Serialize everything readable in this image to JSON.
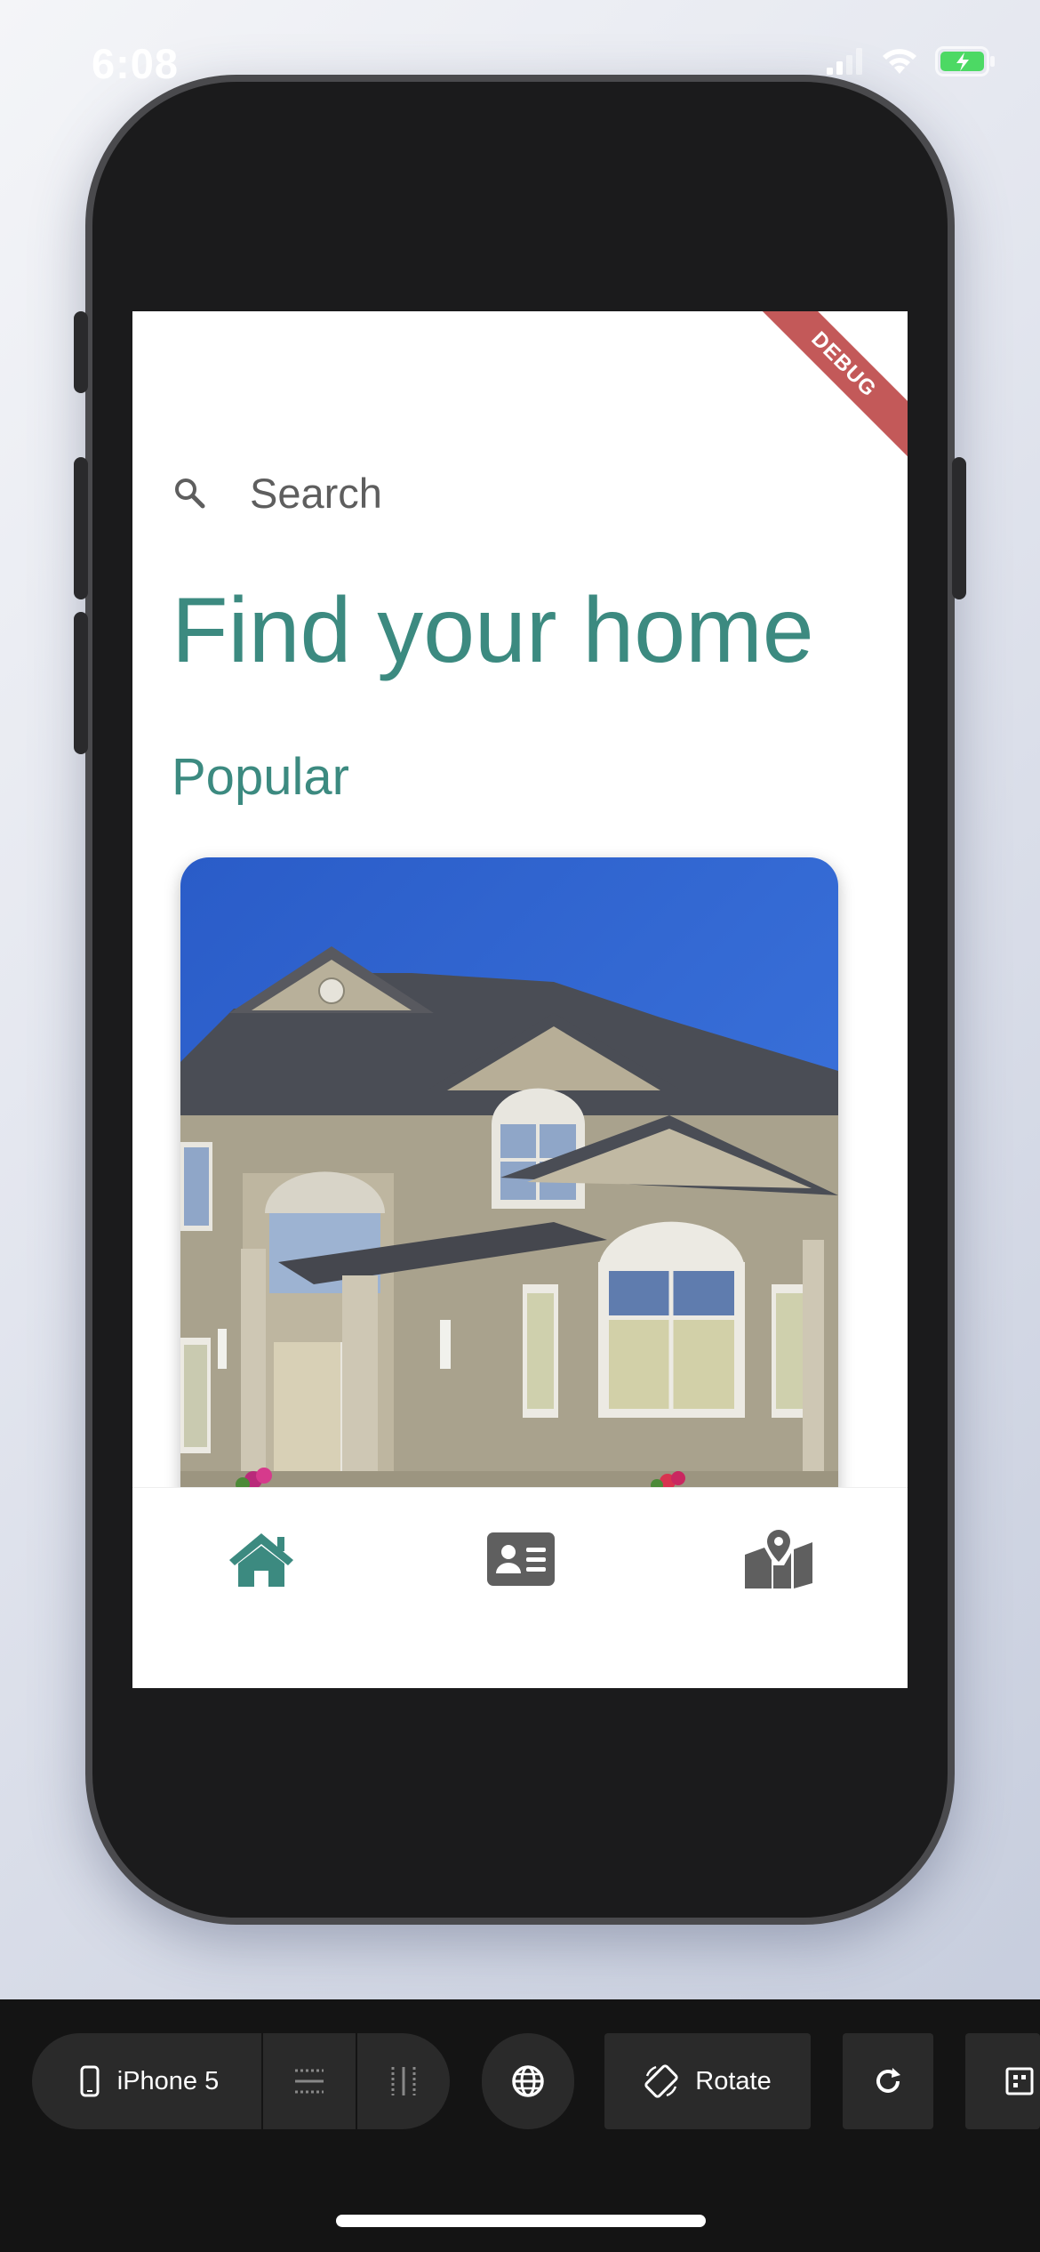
{
  "status_bar": {
    "time": "6:08"
  },
  "app": {
    "debug_banner": "DEBUG",
    "search": {
      "placeholder": "Search"
    },
    "title": "Find your home",
    "section_title": "Popular",
    "nav": {
      "items": [
        {
          "icon": "home-icon",
          "active": true
        },
        {
          "icon": "contact-card-icon",
          "active": false
        },
        {
          "icon": "map-icon",
          "active": false
        }
      ]
    },
    "colors": {
      "accent": "#3c8a80",
      "inactive": "#5f5f5f"
    }
  },
  "toolbar": {
    "device_label": "iPhone 5",
    "rotate_label": "Rotate"
  }
}
